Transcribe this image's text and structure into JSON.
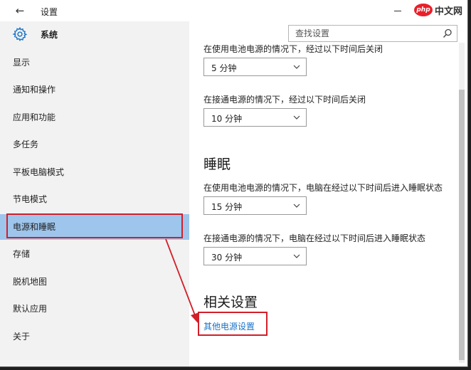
{
  "window": {
    "back_glyph": "←",
    "title": "设置",
    "watermark_logo": "php",
    "watermark_text": "中文网"
  },
  "sidebar": {
    "header": "系统",
    "items": [
      {
        "label": "显示"
      },
      {
        "label": "通知和操作"
      },
      {
        "label": "应用和功能"
      },
      {
        "label": "多任务"
      },
      {
        "label": "平板电脑模式"
      },
      {
        "label": "节电模式"
      },
      {
        "label": "电源和睡眠"
      },
      {
        "label": "存储"
      },
      {
        "label": "脱机地图"
      },
      {
        "label": "默认应用"
      },
      {
        "label": "关于"
      }
    ],
    "active_index": 6
  },
  "search": {
    "placeholder": "查找设置"
  },
  "content": {
    "screen_battery_label": "在使用电池电源的情况下，经过以下时间后关闭",
    "screen_battery_value": "5 分钟",
    "screen_plugged_label": "在接通电源的情况下，经过以下时间后关闭",
    "screen_plugged_value": "10 分钟",
    "sleep_heading": "睡眠",
    "sleep_battery_label": "在使用电池电源的情况下，电脑在经过以下时间后进入睡眠状态",
    "sleep_battery_value": "15 分钟",
    "sleep_plugged_label": "在接通电源的情况下，电脑在经过以下时间后进入睡眠状态",
    "sleep_plugged_value": "30 分钟",
    "related_heading": "相关设置",
    "other_power_link": "其他电源设置"
  },
  "colors": {
    "active_nav": "#9ec5ec",
    "annotation_red": "#d11f29",
    "link_blue": "#1a73c8"
  }
}
